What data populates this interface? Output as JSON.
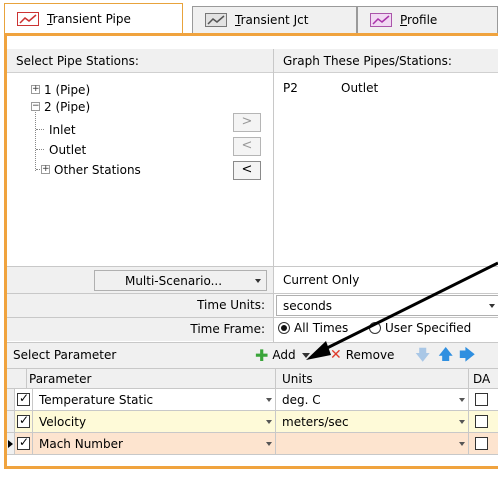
{
  "tabs": [
    {
      "label_u": "T",
      "label_rest": "ransient Pipe",
      "active": true
    },
    {
      "label_u": "T",
      "label_rest": "ransient Jct",
      "active": false
    },
    {
      "label_u": "P",
      "label_rest": "rofile",
      "active": false
    }
  ],
  "stations_panel": {
    "header": "Select Pipe Stations:",
    "tree": [
      {
        "expander": "+",
        "label": "1 (Pipe)"
      },
      {
        "expander": "−",
        "label": "2 (Pipe)"
      },
      {
        "label": "Inlet"
      },
      {
        "label": "Outlet"
      },
      {
        "expander": "+",
        "label": "Other Stations"
      }
    ],
    "move_buttons": [
      ">",
      "<",
      "<"
    ]
  },
  "graph_panel": {
    "header": "Graph These Pipes/Stations:",
    "items": [
      {
        "pipe": "P2",
        "station": "Outlet"
      }
    ]
  },
  "scenario": {
    "dropdown_label": "Multi-Scenario...",
    "value": "Current Only"
  },
  "time_units": {
    "label": "Time Units:",
    "value": "seconds"
  },
  "time_frame": {
    "label": "Time Frame:",
    "options": [
      "All Times",
      "User Specified"
    ],
    "selected": 0
  },
  "param_toolbar": {
    "label": "Select Parameter",
    "add_label": "Add",
    "remove_label": "Remove"
  },
  "param_grid": {
    "headers": [
      "Parameter",
      "Units",
      "DA"
    ],
    "rows": [
      {
        "checked": true,
        "parameter": "Temperature Static",
        "units": "deg. C",
        "da": false,
        "current": false,
        "color": "#ffffff"
      },
      {
        "checked": true,
        "parameter": "Velocity",
        "units": "meters/sec",
        "da": false,
        "current": false,
        "color": "#fefad8"
      },
      {
        "checked": true,
        "parameter": "Mach Number",
        "units": "",
        "da": false,
        "current": true,
        "color": "#fde4cf"
      }
    ]
  },
  "colors": {
    "accent": "#f0a33e",
    "add_green": "#3aa53a",
    "remove_red": "#e03c2c",
    "arrow_blue": "#2f8fe0"
  }
}
